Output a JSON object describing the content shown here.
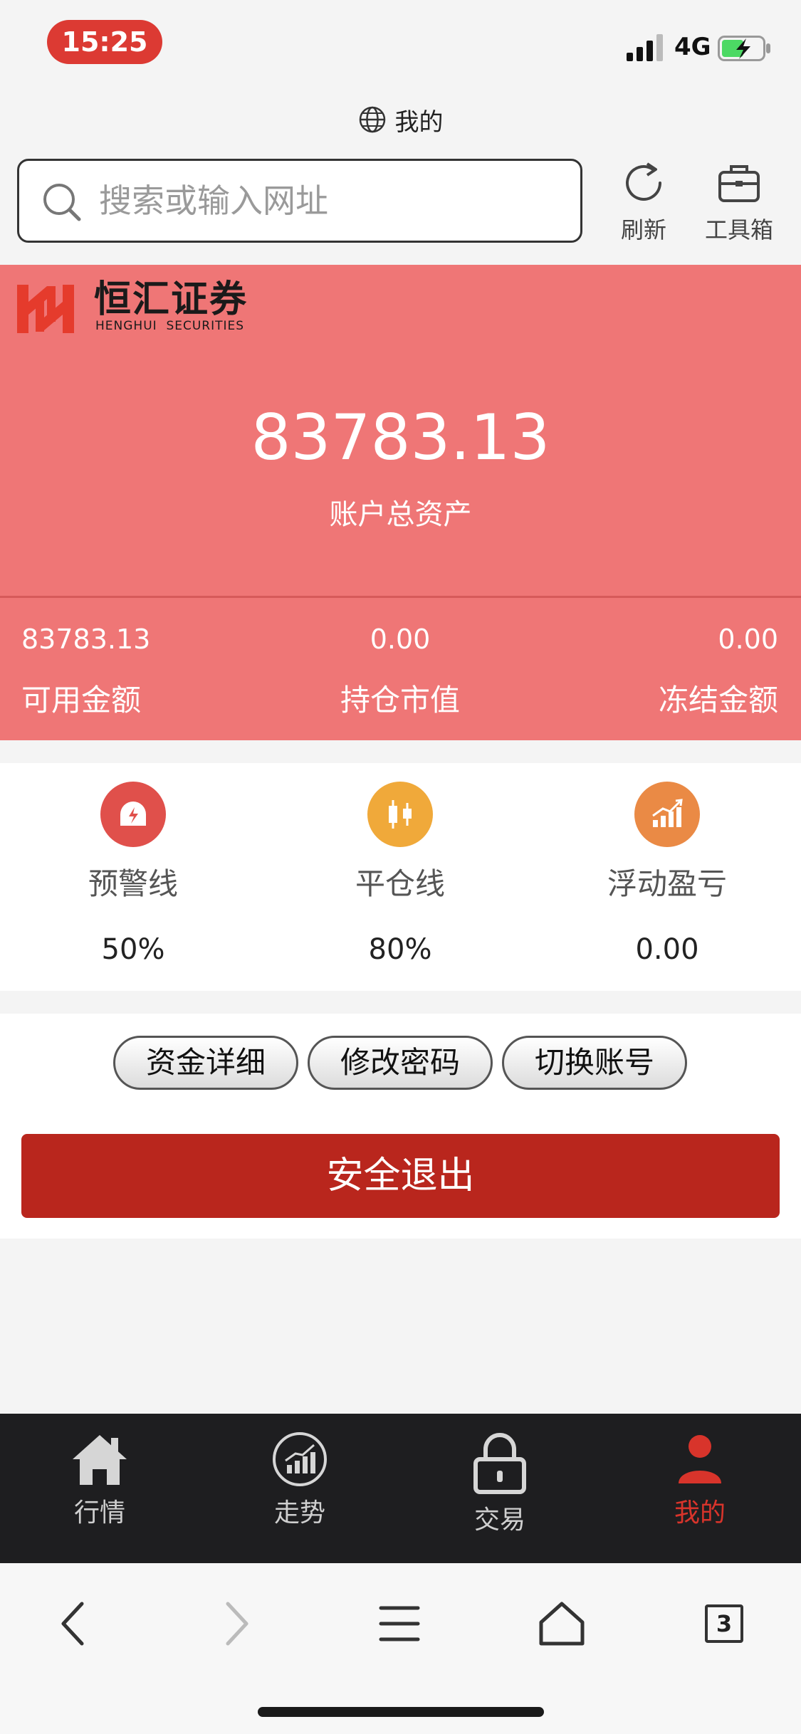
{
  "status_bar": {
    "time": "15:25",
    "network": "4G"
  },
  "browser": {
    "page_title": "我的",
    "search_placeholder": "搜索或输入网址",
    "refresh_label": "刷新",
    "toolbox_label": "工具箱",
    "tab_count": "3"
  },
  "brand": {
    "name_cn": "恒汇证券",
    "name_en": "HENGHUI  SECURITIES",
    "color": "#e53b2c"
  },
  "account": {
    "total_assets": "83783.13",
    "total_assets_label": "账户总资产",
    "stats": [
      {
        "value": "83783.13",
        "label": "可用金额"
      },
      {
        "value": "0.00",
        "label": "持仓市值"
      },
      {
        "value": "0.00",
        "label": "冻结金额"
      }
    ]
  },
  "indicators": [
    {
      "label": "预警线",
      "value": "50%",
      "icon": "warning-alarm-icon",
      "color": "#e0504b"
    },
    {
      "label": "平仓线",
      "value": "80%",
      "icon": "candlestick-icon",
      "color": "#f0a93a"
    },
    {
      "label": "浮动盈亏",
      "value": "0.00",
      "icon": "rising-bars-icon",
      "color": "#ea8a45"
    }
  ],
  "actions": {
    "fund_details": "资金详细",
    "change_password": "修改密码",
    "switch_account": "切换账号",
    "logout": "安全退出"
  },
  "app_nav": [
    {
      "label": "行情",
      "icon": "home-icon"
    },
    {
      "label": "走势",
      "icon": "trend-icon"
    },
    {
      "label": "交易",
      "icon": "lock-icon"
    },
    {
      "label": "我的",
      "icon": "user-icon",
      "active": true
    }
  ],
  "colors": {
    "card": "#ef7676",
    "logout_button": "#b9261d",
    "accent": "#d8342b"
  }
}
